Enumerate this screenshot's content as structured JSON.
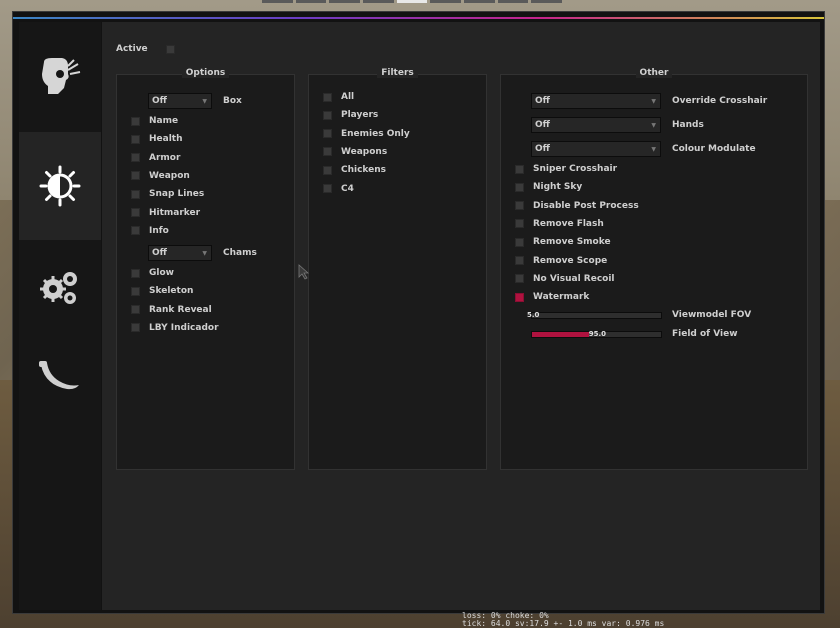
{
  "accent": "#b0123f",
  "sidebar": {
    "tabs": [
      {
        "icon": "aimbot-head-icon",
        "active": false
      },
      {
        "icon": "visuals-contrast-icon",
        "active": true
      },
      {
        "icon": "misc-gears-icon",
        "active": false
      },
      {
        "icon": "skins-knife-icon",
        "active": false
      }
    ]
  },
  "header": {
    "active_label": "Active",
    "active_checked": false
  },
  "options": {
    "title": "Options",
    "box": {
      "value": "Off",
      "label": "Box"
    },
    "items_a": [
      {
        "label": "Name",
        "checked": false
      },
      {
        "label": "Health",
        "checked": false
      },
      {
        "label": "Armor",
        "checked": false
      },
      {
        "label": "Weapon",
        "checked": false
      },
      {
        "label": "Snap Lines",
        "checked": false
      },
      {
        "label": "Hitmarker",
        "checked": false
      },
      {
        "label": "Info",
        "checked": false
      }
    ],
    "chams": {
      "value": "Off",
      "label": "Chams"
    },
    "items_b": [
      {
        "label": "Glow",
        "checked": false
      },
      {
        "label": "Skeleton",
        "checked": false
      },
      {
        "label": "Rank Reveal",
        "checked": false
      },
      {
        "label": "LBY Indicador",
        "checked": false
      }
    ]
  },
  "filters": {
    "title": "Filters",
    "items": [
      {
        "label": "All",
        "checked": false
      },
      {
        "label": "Players",
        "checked": false
      },
      {
        "label": "Enemies Only",
        "checked": false
      },
      {
        "label": "Weapons",
        "checked": false
      },
      {
        "label": "Chickens",
        "checked": false
      },
      {
        "label": "C4",
        "checked": false
      }
    ]
  },
  "other": {
    "title": "Other",
    "dropdowns": [
      {
        "value": "Off",
        "label": "Override Crosshair"
      },
      {
        "value": "Off",
        "label": "Hands"
      },
      {
        "value": "Off",
        "label": "Colour Modulate"
      }
    ],
    "items": [
      {
        "label": "Sniper Crosshair",
        "checked": false
      },
      {
        "label": "Night Sky",
        "checked": false
      },
      {
        "label": "Disable Post Process",
        "checked": false
      },
      {
        "label": "Remove Flash",
        "checked": false
      },
      {
        "label": "Remove Smoke",
        "checked": false
      },
      {
        "label": "Remove Scope",
        "checked": false
      },
      {
        "label": "No Visual Recoil",
        "checked": false
      },
      {
        "label": "Watermark",
        "checked": true
      }
    ],
    "sliders": [
      {
        "value_text": "5.0",
        "label": "Viewmodel FOV",
        "fraction": 0.0
      },
      {
        "value_text": "95.0",
        "label": "Field of View",
        "fraction": 0.44
      }
    ]
  },
  "netgraph": {
    "line1": "loss:  0%  choke:  0%",
    "line2": "tick: 64.0  sv:17.9 +- 1.0 ms   var:  0.976 ms"
  }
}
